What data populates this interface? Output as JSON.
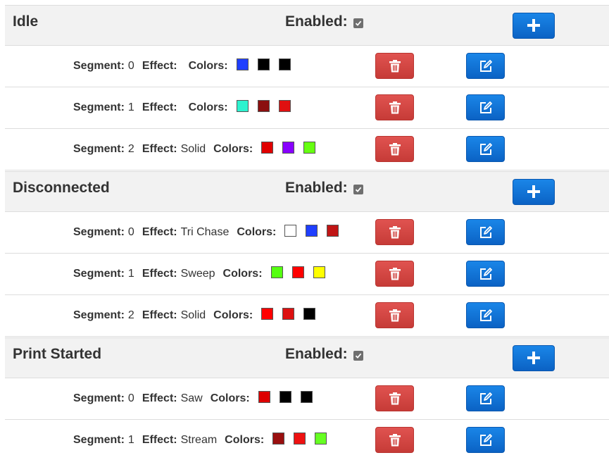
{
  "colors": {
    "header_bg": "#f2f2f2",
    "primary_button": "#0b62c4",
    "danger_button": "#d9534f",
    "checkbox": "#6f6f6f"
  },
  "labels": {
    "enabled": "Enabled:",
    "segment": "Segment:",
    "effect": "Effect:",
    "colors": "Colors:"
  },
  "groups": [
    {
      "name": "Idle",
      "enabled": true,
      "segments": [
        {
          "segment": "0",
          "effect": "",
          "colors": [
            "#1f3fff",
            "#000000",
            "#000000"
          ]
        },
        {
          "segment": "1",
          "effect": "",
          "colors": [
            "#2cf2cf",
            "#8b0f0f",
            "#e01010"
          ]
        },
        {
          "segment": "2",
          "effect": "Solid",
          "colors": [
            "#e00000",
            "#8800ff",
            "#66ff11"
          ]
        }
      ]
    },
    {
      "name": "Disconnected",
      "enabled": true,
      "segments": [
        {
          "segment": "0",
          "effect": "Tri Chase",
          "colors": [
            "#ffffff",
            "#1f3fff",
            "#c01515"
          ]
        },
        {
          "segment": "1",
          "effect": "Sweep",
          "colors": [
            "#55ff11",
            "#ff0000",
            "#ffff00"
          ]
        },
        {
          "segment": "2",
          "effect": "Solid",
          "colors": [
            "#ff0000",
            "#dd1111",
            "#000000"
          ]
        }
      ]
    },
    {
      "name": "Print Started",
      "enabled": true,
      "segments": [
        {
          "segment": "0",
          "effect": "Saw",
          "colors": [
            "#dd0000",
            "#000000",
            "#000000"
          ]
        },
        {
          "segment": "1",
          "effect": "Stream",
          "colors": [
            "#990f0f",
            "#ee1111",
            "#66ff22"
          ]
        }
      ]
    }
  ]
}
